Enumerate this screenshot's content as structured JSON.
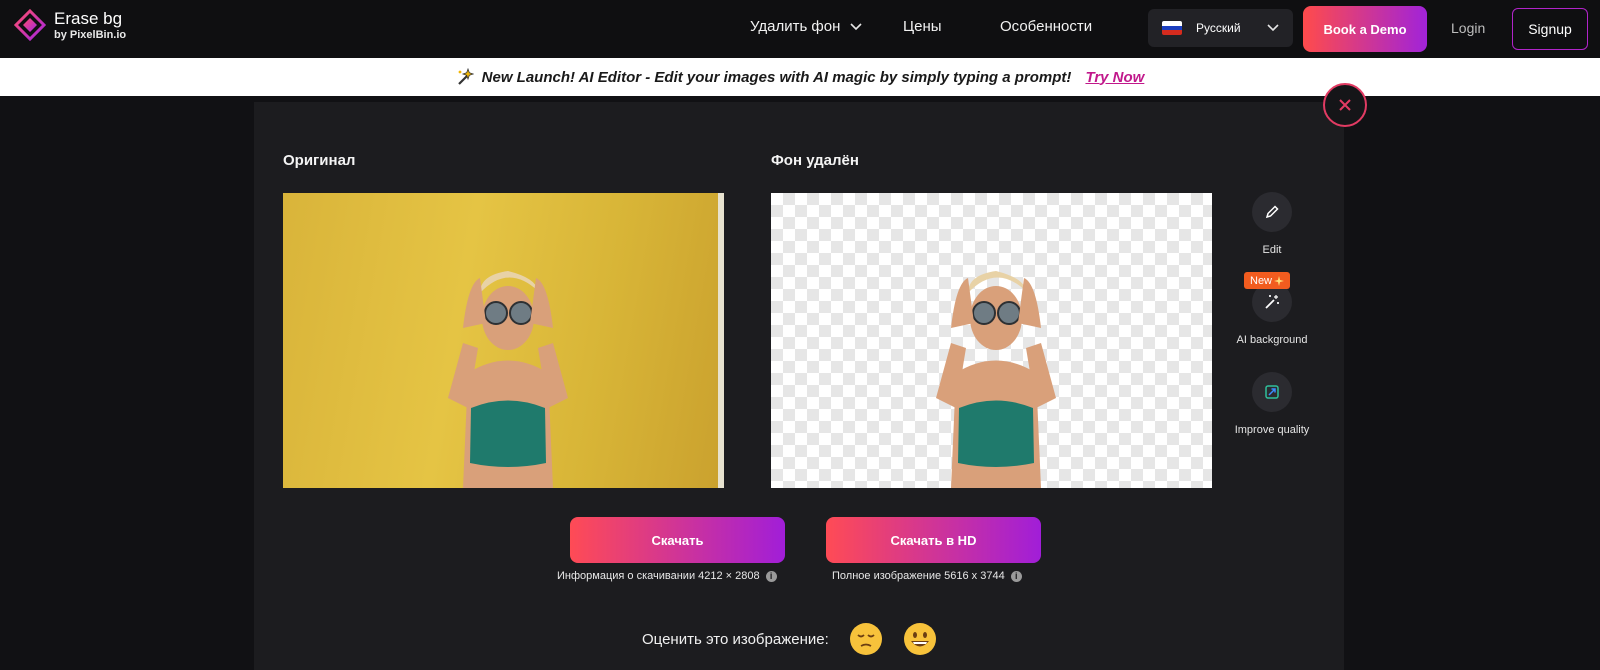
{
  "header": {
    "logo_name": "Erase bg",
    "logo_sub": "by PixelBin.io",
    "nav": {
      "remove_bg": "Удалить фон",
      "prices": "Цены",
      "features": "Особенности"
    },
    "language": "Русский",
    "book_demo": "Book a Demo",
    "login": "Login",
    "signup": "Signup"
  },
  "banner": {
    "text": "New Launch! AI Editor - Edit your images with AI magic by simply typing a prompt!",
    "link": "Try Now"
  },
  "modal": {
    "original_title": "Оригинал",
    "removed_title": "Фон удалён",
    "tools": [
      {
        "label": "Edit",
        "icon": "pencil-icon"
      },
      {
        "label": "AI background",
        "icon": "magic-wand-icon",
        "badge": "New"
      },
      {
        "label": "Improve quality",
        "icon": "improve-quality-icon"
      }
    ],
    "download": {
      "button": "Скачать",
      "info": "Информация о скачивании 4212 × 2808"
    },
    "download_hd": {
      "button": "Скачать в HD",
      "info": "Полное изображение 5616 x 3744"
    },
    "rate_label": "Оценить это изображение:"
  },
  "colors": {
    "accent_start": "#ff4b55",
    "accent_end": "#a11ed8",
    "badge_new": "#f25c1f",
    "link_pink": "#c1188b"
  }
}
